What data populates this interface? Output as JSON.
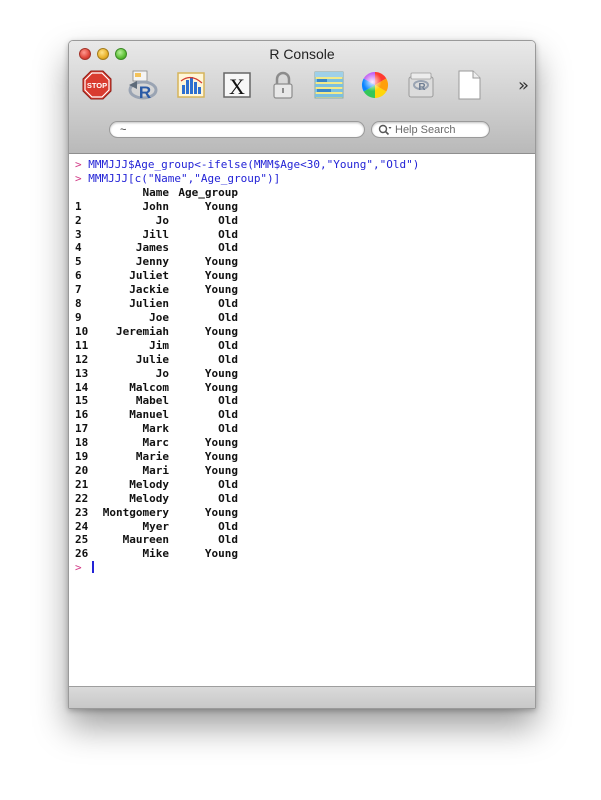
{
  "window": {
    "title": "R Console"
  },
  "toolbar": {
    "buttons": [
      {
        "name": "stop-button",
        "label": "STOP",
        "icon": "stop-sign-icon",
        "color": "#d93b2f"
      },
      {
        "name": "run-button",
        "icon": "r-logo-icon"
      },
      {
        "name": "quartz-button",
        "icon": "bar-chart-icon"
      },
      {
        "name": "x11-button",
        "label": "X",
        "icon": "x11-icon"
      },
      {
        "name": "lock-button",
        "icon": "lock-icon"
      },
      {
        "name": "workspace-button",
        "icon": "spreadsheet-icon"
      },
      {
        "name": "colors-button",
        "icon": "color-wheel-icon"
      },
      {
        "name": "package-button",
        "icon": "package-icon"
      },
      {
        "name": "new-document-button",
        "icon": "blank-page-icon"
      }
    ],
    "overflow_label": "»"
  },
  "path_field": {
    "value": "~"
  },
  "search": {
    "placeholder": "Help Search",
    "icon": "magnifier-icon"
  },
  "console": {
    "prompt": ">",
    "commands": [
      "MMMJJJ$Age_group<-ifelse(MMM$Age<30,\"Young\",\"Old\")",
      "MMMJJJ[c(\"Name\",\"Age_group\")]"
    ],
    "table": {
      "headers": [
        "Name",
        "Age_group"
      ],
      "rows": [
        [
          "1",
          "John",
          "Young"
        ],
        [
          "2",
          "Jo",
          "Old"
        ],
        [
          "3",
          "Jill",
          "Old"
        ],
        [
          "4",
          "James",
          "Old"
        ],
        [
          "5",
          "Jenny",
          "Young"
        ],
        [
          "6",
          "Juliet",
          "Young"
        ],
        [
          "7",
          "Jackie",
          "Young"
        ],
        [
          "8",
          "Julien",
          "Old"
        ],
        [
          "9",
          "Joe",
          "Old"
        ],
        [
          "10",
          "Jeremiah",
          "Young"
        ],
        [
          "11",
          "Jim",
          "Old"
        ],
        [
          "12",
          "Julie",
          "Old"
        ],
        [
          "13",
          "Jo",
          "Young"
        ],
        [
          "14",
          "Malcom",
          "Young"
        ],
        [
          "15",
          "Mabel",
          "Old"
        ],
        [
          "16",
          "Manuel",
          "Old"
        ],
        [
          "17",
          "Mark",
          "Old"
        ],
        [
          "18",
          "Marc",
          "Young"
        ],
        [
          "19",
          "Marie",
          "Young"
        ],
        [
          "20",
          "Mari",
          "Young"
        ],
        [
          "21",
          "Melody",
          "Old"
        ],
        [
          "22",
          "Melody",
          "Old"
        ],
        [
          "23",
          "Montgomery",
          "Young"
        ],
        [
          "24",
          "Myer",
          "Old"
        ],
        [
          "25",
          "Maureen",
          "Old"
        ],
        [
          "26",
          "Mike",
          "Young"
        ]
      ]
    }
  },
  "colors": {
    "command_text": "#2323d6",
    "prompt": "#d23a86",
    "output_text": "#111111"
  }
}
